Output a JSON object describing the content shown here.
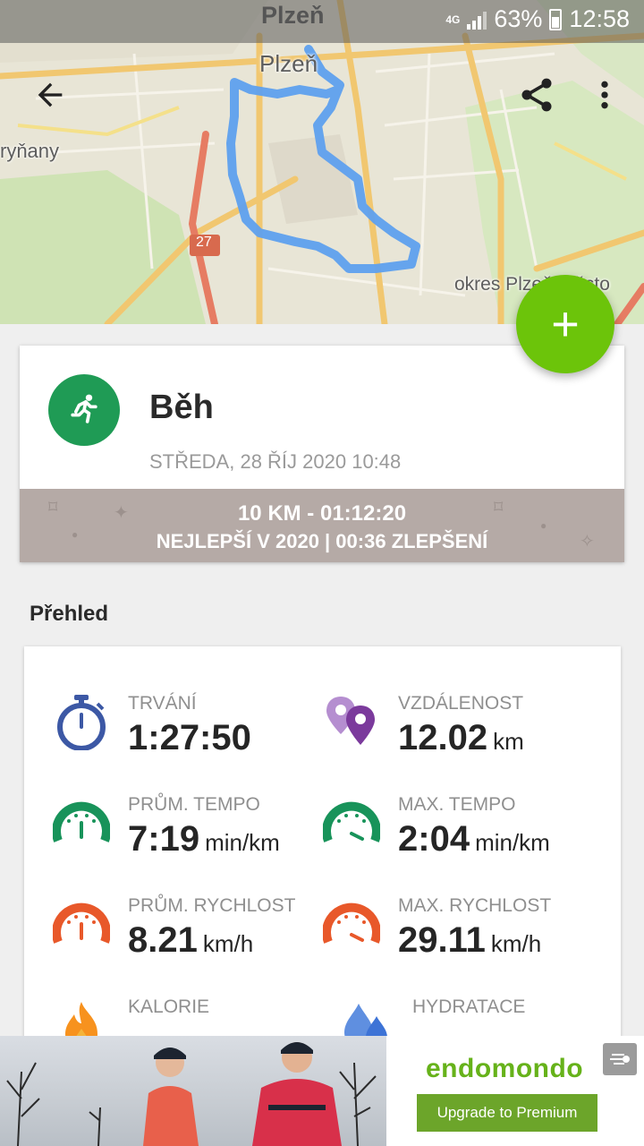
{
  "status_bar": {
    "city": "Plzeň",
    "network": "4G",
    "battery": "63%",
    "time": "12:58"
  },
  "map": {
    "labels": {
      "city": "Plzeň",
      "town": "ryňany",
      "road_number": "27",
      "district": "okres Plzeň-město"
    },
    "route_color": "#5ea0ee"
  },
  "toolbar": {
    "back_icon": "arrow-left-icon",
    "share_icon": "share-icon",
    "more_icon": "more-vertical-icon"
  },
  "fab": {
    "label": "+"
  },
  "workout": {
    "sport": "Běh",
    "date": "STŘEDA, 28 ŘÍJ 2020 10:48",
    "achievement_line1": "10 KM  -  01:12:20",
    "achievement_line2": "NEJLEPŠÍ V 2020  |  00:36 ZLEPŠENÍ",
    "accent": "#1f9b55"
  },
  "overview": {
    "title": "Přehled",
    "stats": [
      {
        "label": "TRVÁNÍ",
        "value": "1:27:50",
        "unit": "",
        "icon": "stopwatch-icon"
      },
      {
        "label": "VZDÁLENOST",
        "value": "12.02",
        "unit": "km",
        "icon": "location-pins-icon"
      },
      {
        "label": "PRŮM. TEMPO",
        "value": "7:19",
        "unit": "min/km",
        "icon": "gauge-green-icon"
      },
      {
        "label": "MAX. TEMPO",
        "value": "2:04",
        "unit": "min/km",
        "icon": "gauge-green-max-icon"
      },
      {
        "label": "PRŮM. RYCHLOST",
        "value": "8.21",
        "unit": "km/h",
        "icon": "gauge-orange-icon"
      },
      {
        "label": "MAX. RYCHLOST",
        "value": "29.11",
        "unit": "km/h",
        "icon": "gauge-orange-max-icon"
      },
      {
        "label": "KALORIE",
        "value": "",
        "unit": "",
        "icon": "flame-icon"
      },
      {
        "label": "HYDRATACE",
        "value": "",
        "unit": "",
        "icon": "water-drops-icon"
      }
    ]
  },
  "ad": {
    "brand": "endomondo",
    "cta": "Upgrade to Premium"
  }
}
